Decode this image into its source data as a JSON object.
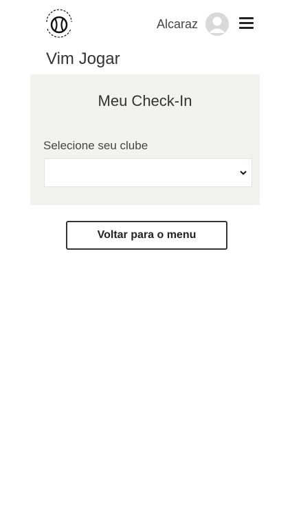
{
  "header": {
    "logo_icon": "quem-quer-jogar-tennis-ball-logo",
    "user_name": "Alcaraz",
    "avatar_icon": "user-avatar-icon",
    "menu_icon": "hamburger-menu-icon"
  },
  "page": {
    "title": "Vim Jogar"
  },
  "checkin": {
    "title": "Meu Check-In",
    "club_label": "Selecione seu clube",
    "club_selected": ""
  },
  "actions": {
    "back_label": "Voltar para o menu"
  },
  "colors": {
    "card_background": "#f4f2ee",
    "text": "#333333",
    "avatar": "#d9d9d9"
  }
}
